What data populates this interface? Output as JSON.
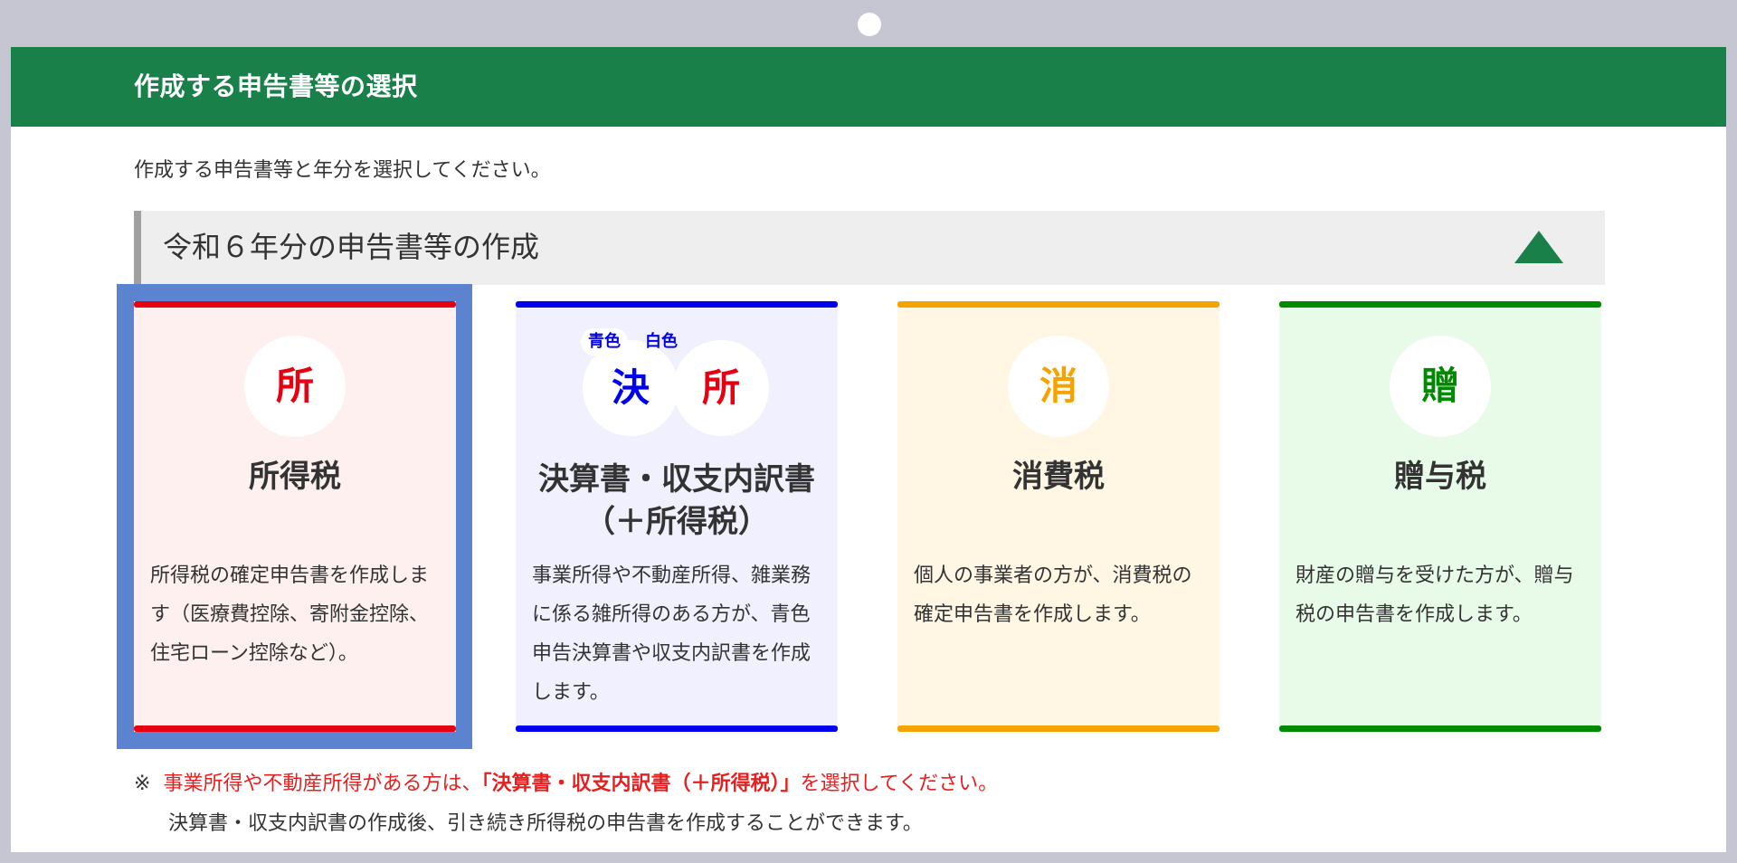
{
  "page": {
    "title": "作成する申告書等の選択",
    "intro": "作成する申告書等と年分を選択してください。"
  },
  "section": {
    "year_title": "令和６年分の申告書等の作成",
    "collapse_icon": "triangle-up-icon"
  },
  "cards": [
    {
      "id": "income-tax",
      "badge": "所",
      "title": "所得税",
      "description": "所得税の確定申告書を作成します（医療費控除、寄附金控除、住宅ローン控除など）。",
      "accent": "#e60012",
      "background": "#fff0f0",
      "selected": true
    },
    {
      "id": "settlement",
      "badge_left": "決",
      "badge_right": "所",
      "tag_blue": "青色",
      "tag_white": "白色",
      "title_line1": "決算書・収支内訳書",
      "title_line2": "（＋所得税）",
      "description": "事業所得や不動産所得、雑業務に係る雑所得のある方が、青色申告決算書や収支内訳書を作成します。",
      "accent": "#0000ee",
      "background": "#f0f0ff",
      "selected": false
    },
    {
      "id": "consumption-tax",
      "badge": "消",
      "title": "消費税",
      "description": "個人の事業者の方が、消費税の確定申告書を作成します。",
      "accent": "#f5a300",
      "background": "#fff6e4",
      "selected": false
    },
    {
      "id": "gift-tax",
      "badge": "贈",
      "title": "贈与税",
      "description": "財産の贈与を受けた方が、贈与税の申告書を作成します。",
      "accent": "#008a00",
      "background": "#e8fae8",
      "selected": false
    }
  ],
  "note": {
    "mark": "※",
    "text_before": "事業所得や不動産所得がある方は、",
    "text_bold": "「決算書・収支内訳書（＋所得税）」",
    "text_after": "を選択してください。",
    "line2": "決算書・収支内訳書の作成後、引き続き所得税の申告書を作成することができます。"
  }
}
